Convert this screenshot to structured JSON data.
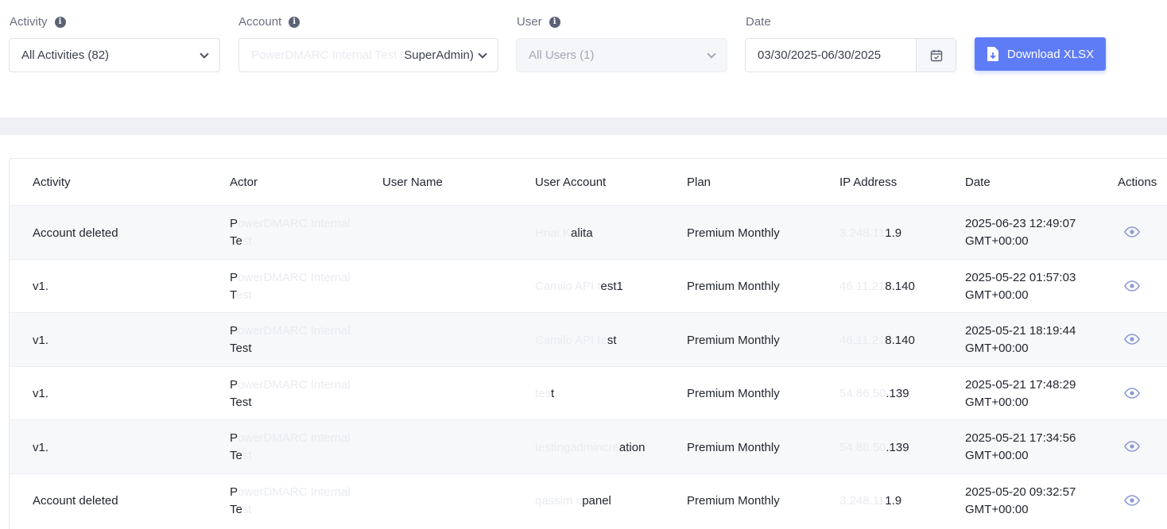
{
  "filters": {
    "activity": {
      "label": "Activity",
      "value": "All Activities (82)"
    },
    "account": {
      "label": "Account",
      "value_faded": "PowerDMARC Internal Test (",
      "value": "SuperAdmin)"
    },
    "user": {
      "label": "User",
      "value": "All Users (1)"
    },
    "date": {
      "label": "Date",
      "value": "03/30/2025-06/30/2025"
    },
    "download_label": "Download XLSX"
  },
  "table": {
    "headers": [
      "Activity",
      "Actor",
      "User Name",
      "User Account",
      "Plan",
      "IP Address",
      "Date",
      "Actions"
    ],
    "rows": [
      {
        "activity": "Account deleted",
        "actor_a": "P",
        "actor_a_faded": "owerDMARC Internal",
        "actor_b": "Te",
        "actor_b_faded": "st",
        "account_faded": "Hriai K",
        "account": "alita",
        "plan": "Premium Monthly",
        "ip_faded": "3.248.11",
        "ip": "1.9",
        "date_a": "2025-06-23 12:49:07",
        "date_b": "GMT+00:00"
      },
      {
        "activity": "v1.",
        "actor_a": "P",
        "actor_a_faded": "owerDMARC Internal",
        "actor_b": "T",
        "actor_b_faded": "est",
        "account_faded": "Camilo API t",
        "account": "est1",
        "plan": "Premium Monthly",
        "ip_faded": "46.11.21",
        "ip": "8.140",
        "date_a": "2025-05-22 01:57:03",
        "date_b": "GMT+00:00"
      },
      {
        "activity": "v1.",
        "actor_a": "P",
        "actor_a_faded": "owerDMARC Internal",
        "actor_b": "Test",
        "actor_b_faded": "",
        "account_faded": "Camilo API te",
        "account": "st",
        "plan": "Premium Monthly",
        "ip_faded": "46.11.21",
        "ip": "8.140",
        "date_a": "2025-05-21 18:19:44",
        "date_b": "GMT+00:00"
      },
      {
        "activity": "v1.",
        "actor_a": "P",
        "actor_a_faded": "owerDMARC Internal",
        "actor_b": "Test",
        "actor_b_faded": "",
        "account_faded": "tes",
        "account": "t",
        "plan": "Premium Monthly",
        "ip_faded": "54.86.50",
        "ip": ".139",
        "date_a": "2025-05-21 17:48:29",
        "date_b": "GMT+00:00"
      },
      {
        "activity": "v1.",
        "actor_a": "P",
        "actor_a_faded": "owerDMARC Internal",
        "actor_b": "Te",
        "actor_b_faded": "st",
        "account_faded": "testingadmincre",
        "account": "ation",
        "plan": "Premium Monthly",
        "ip_faded": "54.86.50",
        "ip": ".139",
        "date_a": "2025-05-21 17:34:56",
        "date_b": "GMT+00:00"
      },
      {
        "activity": "Account deleted",
        "actor_a": "P",
        "actor_a_faded": "owerDMARC Internal",
        "actor_b": "Te",
        "actor_b_faded": "st",
        "account_faded": "qassim c",
        "account": "panel",
        "plan": "Premium Monthly",
        "ip_faded": "3.248.11",
        "ip": "1.9",
        "date_a": "2025-05-20 09:32:57",
        "date_b": "GMT+00:00"
      }
    ]
  },
  "colors": {
    "accent": "#5e7cf5",
    "eye": "#8c9ad6"
  },
  "icons": {
    "info": "info-icon",
    "chevron": "chevron-down-icon",
    "calendar": "calendar-icon",
    "download": "file-download-icon",
    "view": "eye-icon"
  }
}
